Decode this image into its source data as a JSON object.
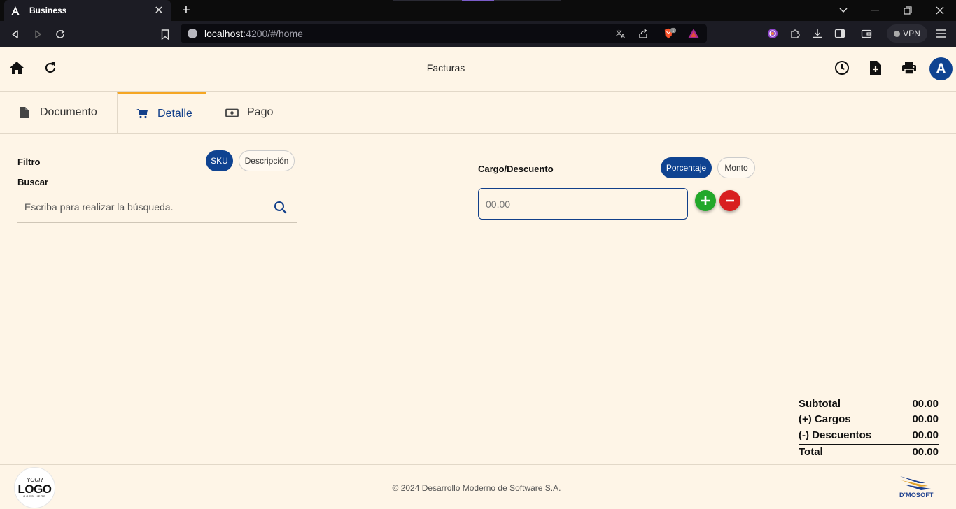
{
  "browser": {
    "tab_title": "Business",
    "url_host": "localhost",
    "url_rest": ":4200/#/home",
    "vpn_label": "VPN",
    "brave_badge": "1"
  },
  "header": {
    "title": "Facturas",
    "avatar_initial": "A"
  },
  "tabs": [
    {
      "label": "Documento",
      "icon": "file-icon",
      "active": false
    },
    {
      "label": "Detalle",
      "icon": "cart-icon",
      "active": true
    },
    {
      "label": "Pago",
      "icon": "money-icon",
      "active": false
    }
  ],
  "filter": {
    "label": "Filtro",
    "options": [
      "SKU",
      "Descripción"
    ],
    "selected": "SKU",
    "search_label": "Buscar",
    "search_placeholder": "Escriba para realizar la búsqueda."
  },
  "cargo": {
    "label": "Cargo/Descuento",
    "options": [
      "Porcentaje",
      "Monto"
    ],
    "selected": "Porcentaje",
    "amount_placeholder": "00.00"
  },
  "totals": [
    {
      "label": "Subtotal",
      "value": "00.00"
    },
    {
      "label": "(+) Cargos",
      "value": "00.00"
    },
    {
      "label": "(-) Descuentos",
      "value": "00.00"
    },
    {
      "label": "Total",
      "value": "00.00"
    }
  ],
  "footer": {
    "copyright": "© 2024 Desarrollo Moderno de Software S.A.",
    "logo_top": "YOUR",
    "logo_main": "LOGO",
    "logo_sub": "GOES HERE",
    "brand": "D'MOSOFT"
  },
  "colors": {
    "page_bg": "#fef5e7",
    "primary": "#0f4391",
    "tab_accent": "#f5a623",
    "add_green": "#22a82a",
    "remove_red": "#d81f1f"
  }
}
